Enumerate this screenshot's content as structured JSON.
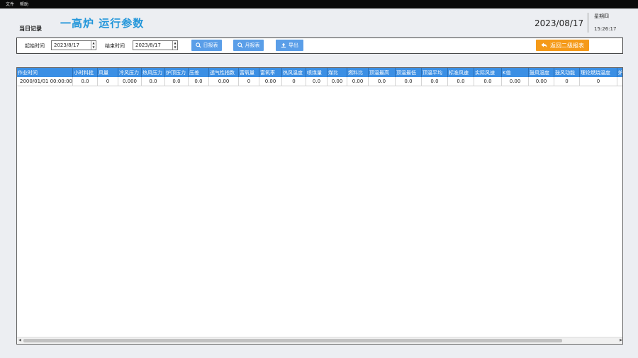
{
  "menu": {
    "file": "文件",
    "help": "帮助"
  },
  "header": {
    "record_label": "当日记录",
    "title": "一高炉 运行参数",
    "date": "2023/08/17",
    "weekday": "星期四",
    "time": "15:26:17"
  },
  "toolbar": {
    "start_label": "起始时间",
    "start_value": "2023/8/17",
    "end_label": "结束时间",
    "end_value": "2023/8/17",
    "daily_report": "日报表",
    "monthly_report": "月报表",
    "export": "导出",
    "back": "返回二级报表"
  },
  "table": {
    "columns": [
      "作业时间",
      "小时料批",
      "风量",
      "冷风压力",
      "热风压力",
      "炉顶压力",
      "压差",
      "透气性指数",
      "富氧量",
      "富氧率",
      "热风温度",
      "喷煤量",
      "煤比",
      "燃料比",
      "顶温最高",
      "顶温最低",
      "顶温平均",
      "标准风速",
      "实际风速",
      "K值",
      "鼓风湿度",
      "鼓风动能",
      "理论燃烧温度",
      "炉"
    ],
    "rows": [
      [
        "2000/01/01 00:00:00",
        "0.0",
        "0",
        "0.000",
        "0.0",
        "0.0",
        "0.0",
        "0.00",
        "0",
        "0.00",
        "0",
        "0.0",
        "0.00",
        "0.00",
        "0.0",
        "0.0",
        "0.0",
        "0.0",
        "0.0",
        "0.00",
        "0.00",
        "0",
        "0",
        ""
      ]
    ]
  },
  "colors": {
    "accent": "#2396da",
    "header_bg": "#3b8fe4",
    "button_blue": "#5a9ee8",
    "button_orange": "#f59a18"
  }
}
